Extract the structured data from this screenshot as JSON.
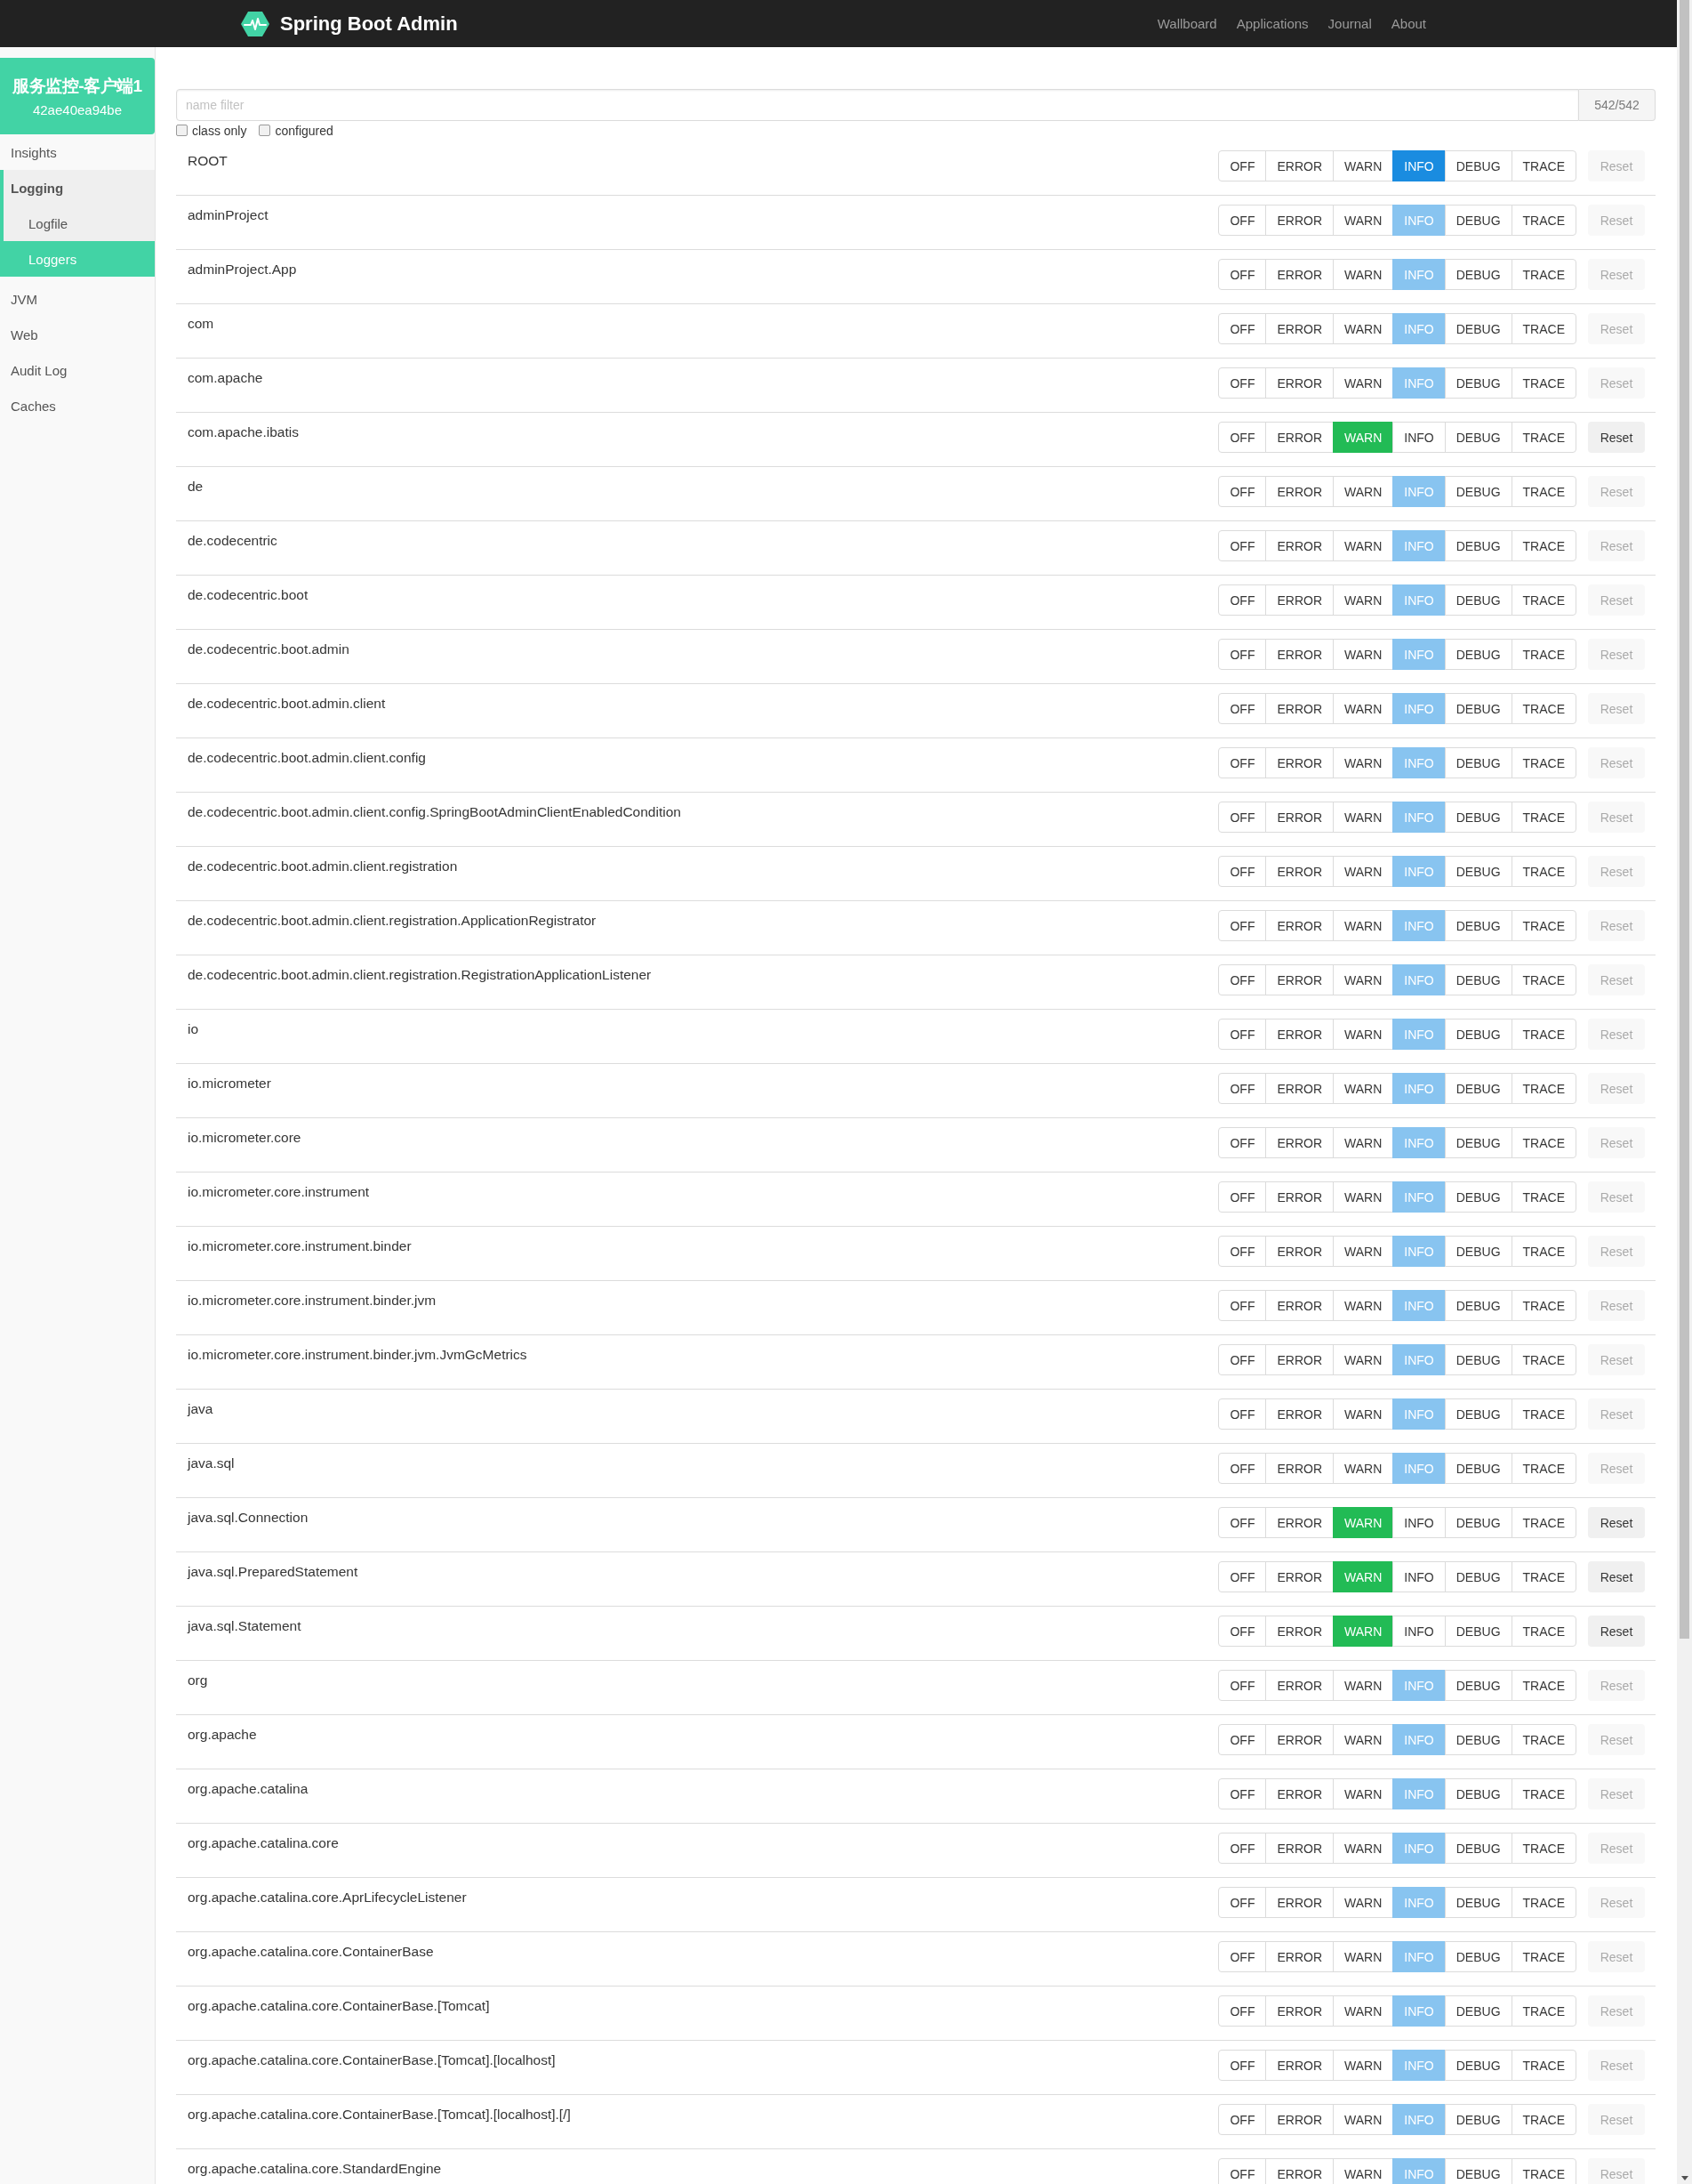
{
  "navbar": {
    "brand": "Spring Boot Admin",
    "links": [
      "Wallboard",
      "Applications",
      "Journal",
      "About"
    ]
  },
  "sidebar": {
    "app_name": "服务监控-客户端1",
    "instance_id": "42ae40ea94be",
    "items": [
      {
        "label": "Insights",
        "active": false
      },
      {
        "label": "Logging",
        "active": true,
        "children": [
          {
            "label": "Logfile",
            "selected": false
          },
          {
            "label": "Loggers",
            "selected": true
          }
        ]
      },
      {
        "label": "JVM",
        "active": false
      },
      {
        "label": "Web",
        "active": false
      },
      {
        "label": "Audit Log",
        "active": false
      },
      {
        "label": "Caches",
        "active": false
      }
    ]
  },
  "filter": {
    "placeholder": "name filter",
    "count": "542/542",
    "options": [
      {
        "label": "class only",
        "checked": false
      },
      {
        "label": "configured",
        "checked": false
      }
    ]
  },
  "loggers": [
    {
      "name": "ROOT",
      "configured": true,
      "levels": [
        {
          "label": "OFF",
          "selected": false
        },
        {
          "label": "ERROR",
          "selected": false
        },
        {
          "label": "WARN",
          "selected": false
        },
        {
          "label": "INFO",
          "selected": true
        },
        {
          "label": "DEBUG",
          "selected": false
        },
        {
          "label": "TRACE",
          "selected": false
        }
      ],
      "reset": {
        "label": "Reset",
        "disabled": true
      }
    },
    {
      "name": "adminProject",
      "configured": false,
      "levels": [
        {
          "label": "OFF",
          "selected": false
        },
        {
          "label": "ERROR",
          "selected": false
        },
        {
          "label": "WARN",
          "selected": false
        },
        {
          "label": "INFO",
          "selected": true
        },
        {
          "label": "DEBUG",
          "selected": false
        },
        {
          "label": "TRACE",
          "selected": false
        }
      ],
      "reset": {
        "label": "Reset",
        "disabled": true
      }
    },
    {
      "name": "adminProject.App",
      "configured": false,
      "levels": [
        {
          "label": "OFF",
          "selected": false
        },
        {
          "label": "ERROR",
          "selected": false
        },
        {
          "label": "WARN",
          "selected": false
        },
        {
          "label": "INFO",
          "selected": true
        },
        {
          "label": "DEBUG",
          "selected": false
        },
        {
          "label": "TRACE",
          "selected": false
        }
      ],
      "reset": {
        "label": "Reset",
        "disabled": true
      }
    },
    {
      "name": "com",
      "configured": false,
      "levels": [
        {
          "label": "OFF",
          "selected": false
        },
        {
          "label": "ERROR",
          "selected": false
        },
        {
          "label": "WARN",
          "selected": false
        },
        {
          "label": "INFO",
          "selected": true
        },
        {
          "label": "DEBUG",
          "selected": false
        },
        {
          "label": "TRACE",
          "selected": false
        }
      ],
      "reset": {
        "label": "Reset",
        "disabled": true
      }
    },
    {
      "name": "com.apache",
      "configured": false,
      "levels": [
        {
          "label": "OFF",
          "selected": false
        },
        {
          "label": "ERROR",
          "selected": false
        },
        {
          "label": "WARN",
          "selected": false
        },
        {
          "label": "INFO",
          "selected": true
        },
        {
          "label": "DEBUG",
          "selected": false
        },
        {
          "label": "TRACE",
          "selected": false
        }
      ],
      "reset": {
        "label": "Reset",
        "disabled": true
      }
    },
    {
      "name": "com.apache.ibatis",
      "configured": true,
      "levels": [
        {
          "label": "OFF",
          "selected": false
        },
        {
          "label": "ERROR",
          "selected": false
        },
        {
          "label": "WARN",
          "selected": true
        },
        {
          "label": "INFO",
          "selected": false
        },
        {
          "label": "DEBUG",
          "selected": false
        },
        {
          "label": "TRACE",
          "selected": false
        }
      ],
      "reset": {
        "label": "Reset",
        "disabled": false
      }
    },
    {
      "name": "de",
      "configured": false,
      "levels": [
        {
          "label": "OFF",
          "selected": false
        },
        {
          "label": "ERROR",
          "selected": false
        },
        {
          "label": "WARN",
          "selected": false
        },
        {
          "label": "INFO",
          "selected": true
        },
        {
          "label": "DEBUG",
          "selected": false
        },
        {
          "label": "TRACE",
          "selected": false
        }
      ],
      "reset": {
        "label": "Reset",
        "disabled": true
      }
    },
    {
      "name": "de.codecentric",
      "configured": false,
      "levels": [
        {
          "label": "OFF",
          "selected": false
        },
        {
          "label": "ERROR",
          "selected": false
        },
        {
          "label": "WARN",
          "selected": false
        },
        {
          "label": "INFO",
          "selected": true
        },
        {
          "label": "DEBUG",
          "selected": false
        },
        {
          "label": "TRACE",
          "selected": false
        }
      ],
      "reset": {
        "label": "Reset",
        "disabled": true
      }
    },
    {
      "name": "de.codecentric.boot",
      "configured": false,
      "levels": [
        {
          "label": "OFF",
          "selected": false
        },
        {
          "label": "ERROR",
          "selected": false
        },
        {
          "label": "WARN",
          "selected": false
        },
        {
          "label": "INFO",
          "selected": true
        },
        {
          "label": "DEBUG",
          "selected": false
        },
        {
          "label": "TRACE",
          "selected": false
        }
      ],
      "reset": {
        "label": "Reset",
        "disabled": true
      }
    },
    {
      "name": "de.codecentric.boot.admin",
      "configured": false,
      "levels": [
        {
          "label": "OFF",
          "selected": false
        },
        {
          "label": "ERROR",
          "selected": false
        },
        {
          "label": "WARN",
          "selected": false
        },
        {
          "label": "INFO",
          "selected": true
        },
        {
          "label": "DEBUG",
          "selected": false
        },
        {
          "label": "TRACE",
          "selected": false
        }
      ],
      "reset": {
        "label": "Reset",
        "disabled": true
      }
    },
    {
      "name": "de.codecentric.boot.admin.client",
      "configured": false,
      "levels": [
        {
          "label": "OFF",
          "selected": false
        },
        {
          "label": "ERROR",
          "selected": false
        },
        {
          "label": "WARN",
          "selected": false
        },
        {
          "label": "INFO",
          "selected": true
        },
        {
          "label": "DEBUG",
          "selected": false
        },
        {
          "label": "TRACE",
          "selected": false
        }
      ],
      "reset": {
        "label": "Reset",
        "disabled": true
      }
    },
    {
      "name": "de.codecentric.boot.admin.client.config",
      "configured": false,
      "levels": [
        {
          "label": "OFF",
          "selected": false
        },
        {
          "label": "ERROR",
          "selected": false
        },
        {
          "label": "WARN",
          "selected": false
        },
        {
          "label": "INFO",
          "selected": true
        },
        {
          "label": "DEBUG",
          "selected": false
        },
        {
          "label": "TRACE",
          "selected": false
        }
      ],
      "reset": {
        "label": "Reset",
        "disabled": true
      }
    },
    {
      "name": "de.codecentric.boot.admin.client.config.SpringBootAdminClientEnabledCondition",
      "configured": false,
      "levels": [
        {
          "label": "OFF",
          "selected": false
        },
        {
          "label": "ERROR",
          "selected": false
        },
        {
          "label": "WARN",
          "selected": false
        },
        {
          "label": "INFO",
          "selected": true
        },
        {
          "label": "DEBUG",
          "selected": false
        },
        {
          "label": "TRACE",
          "selected": false
        }
      ],
      "reset": {
        "label": "Reset",
        "disabled": true
      }
    },
    {
      "name": "de.codecentric.boot.admin.client.registration",
      "configured": false,
      "levels": [
        {
          "label": "OFF",
          "selected": false
        },
        {
          "label": "ERROR",
          "selected": false
        },
        {
          "label": "WARN",
          "selected": false
        },
        {
          "label": "INFO",
          "selected": true
        },
        {
          "label": "DEBUG",
          "selected": false
        },
        {
          "label": "TRACE",
          "selected": false
        }
      ],
      "reset": {
        "label": "Reset",
        "disabled": true
      }
    },
    {
      "name": "de.codecentric.boot.admin.client.registration.ApplicationRegistrator",
      "configured": false,
      "levels": [
        {
          "label": "OFF",
          "selected": false
        },
        {
          "label": "ERROR",
          "selected": false
        },
        {
          "label": "WARN",
          "selected": false
        },
        {
          "label": "INFO",
          "selected": true
        },
        {
          "label": "DEBUG",
          "selected": false
        },
        {
          "label": "TRACE",
          "selected": false
        }
      ],
      "reset": {
        "label": "Reset",
        "disabled": true
      }
    },
    {
      "name": "de.codecentric.boot.admin.client.registration.RegistrationApplicationListener",
      "configured": false,
      "levels": [
        {
          "label": "OFF",
          "selected": false
        },
        {
          "label": "ERROR",
          "selected": false
        },
        {
          "label": "WARN",
          "selected": false
        },
        {
          "label": "INFO",
          "selected": true
        },
        {
          "label": "DEBUG",
          "selected": false
        },
        {
          "label": "TRACE",
          "selected": false
        }
      ],
      "reset": {
        "label": "Reset",
        "disabled": true
      }
    },
    {
      "name": "io",
      "configured": false,
      "levels": [
        {
          "label": "OFF",
          "selected": false
        },
        {
          "label": "ERROR",
          "selected": false
        },
        {
          "label": "WARN",
          "selected": false
        },
        {
          "label": "INFO",
          "selected": true
        },
        {
          "label": "DEBUG",
          "selected": false
        },
        {
          "label": "TRACE",
          "selected": false
        }
      ],
      "reset": {
        "label": "Reset",
        "disabled": true
      }
    },
    {
      "name": "io.micrometer",
      "configured": false,
      "levels": [
        {
          "label": "OFF",
          "selected": false
        },
        {
          "label": "ERROR",
          "selected": false
        },
        {
          "label": "WARN",
          "selected": false
        },
        {
          "label": "INFO",
          "selected": true
        },
        {
          "label": "DEBUG",
          "selected": false
        },
        {
          "label": "TRACE",
          "selected": false
        }
      ],
      "reset": {
        "label": "Reset",
        "disabled": true
      }
    },
    {
      "name": "io.micrometer.core",
      "configured": false,
      "levels": [
        {
          "label": "OFF",
          "selected": false
        },
        {
          "label": "ERROR",
          "selected": false
        },
        {
          "label": "WARN",
          "selected": false
        },
        {
          "label": "INFO",
          "selected": true
        },
        {
          "label": "DEBUG",
          "selected": false
        },
        {
          "label": "TRACE",
          "selected": false
        }
      ],
      "reset": {
        "label": "Reset",
        "disabled": true
      }
    },
    {
      "name": "io.micrometer.core.instrument",
      "configured": false,
      "levels": [
        {
          "label": "OFF",
          "selected": false
        },
        {
          "label": "ERROR",
          "selected": false
        },
        {
          "label": "WARN",
          "selected": false
        },
        {
          "label": "INFO",
          "selected": true
        },
        {
          "label": "DEBUG",
          "selected": false
        },
        {
          "label": "TRACE",
          "selected": false
        }
      ],
      "reset": {
        "label": "Reset",
        "disabled": true
      }
    },
    {
      "name": "io.micrometer.core.instrument.binder",
      "configured": false,
      "levels": [
        {
          "label": "OFF",
          "selected": false
        },
        {
          "label": "ERROR",
          "selected": false
        },
        {
          "label": "WARN",
          "selected": false
        },
        {
          "label": "INFO",
          "selected": true
        },
        {
          "label": "DEBUG",
          "selected": false
        },
        {
          "label": "TRACE",
          "selected": false
        }
      ],
      "reset": {
        "label": "Reset",
        "disabled": true
      }
    },
    {
      "name": "io.micrometer.core.instrument.binder.jvm",
      "configured": false,
      "levels": [
        {
          "label": "OFF",
          "selected": false
        },
        {
          "label": "ERROR",
          "selected": false
        },
        {
          "label": "WARN",
          "selected": false
        },
        {
          "label": "INFO",
          "selected": true
        },
        {
          "label": "DEBUG",
          "selected": false
        },
        {
          "label": "TRACE",
          "selected": false
        }
      ],
      "reset": {
        "label": "Reset",
        "disabled": true
      }
    },
    {
      "name": "io.micrometer.core.instrument.binder.jvm.JvmGcMetrics",
      "configured": false,
      "levels": [
        {
          "label": "OFF",
          "selected": false
        },
        {
          "label": "ERROR",
          "selected": false
        },
        {
          "label": "WARN",
          "selected": false
        },
        {
          "label": "INFO",
          "selected": true
        },
        {
          "label": "DEBUG",
          "selected": false
        },
        {
          "label": "TRACE",
          "selected": false
        }
      ],
      "reset": {
        "label": "Reset",
        "disabled": true
      }
    },
    {
      "name": "java",
      "configured": false,
      "levels": [
        {
          "label": "OFF",
          "selected": false
        },
        {
          "label": "ERROR",
          "selected": false
        },
        {
          "label": "WARN",
          "selected": false
        },
        {
          "label": "INFO",
          "selected": true
        },
        {
          "label": "DEBUG",
          "selected": false
        },
        {
          "label": "TRACE",
          "selected": false
        }
      ],
      "reset": {
        "label": "Reset",
        "disabled": true
      }
    },
    {
      "name": "java.sql",
      "configured": false,
      "levels": [
        {
          "label": "OFF",
          "selected": false
        },
        {
          "label": "ERROR",
          "selected": false
        },
        {
          "label": "WARN",
          "selected": false
        },
        {
          "label": "INFO",
          "selected": true
        },
        {
          "label": "DEBUG",
          "selected": false
        },
        {
          "label": "TRACE",
          "selected": false
        }
      ],
      "reset": {
        "label": "Reset",
        "disabled": true
      }
    },
    {
      "name": "java.sql.Connection",
      "configured": true,
      "levels": [
        {
          "label": "OFF",
          "selected": false
        },
        {
          "label": "ERROR",
          "selected": false
        },
        {
          "label": "WARN",
          "selected": true
        },
        {
          "label": "INFO",
          "selected": false
        },
        {
          "label": "DEBUG",
          "selected": false
        },
        {
          "label": "TRACE",
          "selected": false
        }
      ],
      "reset": {
        "label": "Reset",
        "disabled": false
      }
    },
    {
      "name": "java.sql.PreparedStatement",
      "configured": true,
      "levels": [
        {
          "label": "OFF",
          "selected": false
        },
        {
          "label": "ERROR",
          "selected": false
        },
        {
          "label": "WARN",
          "selected": true
        },
        {
          "label": "INFO",
          "selected": false
        },
        {
          "label": "DEBUG",
          "selected": false
        },
        {
          "label": "TRACE",
          "selected": false
        }
      ],
      "reset": {
        "label": "Reset",
        "disabled": false
      }
    },
    {
      "name": "java.sql.Statement",
      "configured": true,
      "levels": [
        {
          "label": "OFF",
          "selected": false
        },
        {
          "label": "ERROR",
          "selected": false
        },
        {
          "label": "WARN",
          "selected": true
        },
        {
          "label": "INFO",
          "selected": false
        },
        {
          "label": "DEBUG",
          "selected": false
        },
        {
          "label": "TRACE",
          "selected": false
        }
      ],
      "reset": {
        "label": "Reset",
        "disabled": false
      }
    },
    {
      "name": "org",
      "configured": false,
      "levels": [
        {
          "label": "OFF",
          "selected": false
        },
        {
          "label": "ERROR",
          "selected": false
        },
        {
          "label": "WARN",
          "selected": false
        },
        {
          "label": "INFO",
          "selected": true
        },
        {
          "label": "DEBUG",
          "selected": false
        },
        {
          "label": "TRACE",
          "selected": false
        }
      ],
      "reset": {
        "label": "Reset",
        "disabled": true
      }
    },
    {
      "name": "org.apache",
      "configured": false,
      "levels": [
        {
          "label": "OFF",
          "selected": false
        },
        {
          "label": "ERROR",
          "selected": false
        },
        {
          "label": "WARN",
          "selected": false
        },
        {
          "label": "INFO",
          "selected": true
        },
        {
          "label": "DEBUG",
          "selected": false
        },
        {
          "label": "TRACE",
          "selected": false
        }
      ],
      "reset": {
        "label": "Reset",
        "disabled": true
      }
    },
    {
      "name": "org.apache.catalina",
      "configured": false,
      "levels": [
        {
          "label": "OFF",
          "selected": false
        },
        {
          "label": "ERROR",
          "selected": false
        },
        {
          "label": "WARN",
          "selected": false
        },
        {
          "label": "INFO",
          "selected": true
        },
        {
          "label": "DEBUG",
          "selected": false
        },
        {
          "label": "TRACE",
          "selected": false
        }
      ],
      "reset": {
        "label": "Reset",
        "disabled": true
      }
    },
    {
      "name": "org.apache.catalina.core",
      "configured": false,
      "levels": [
        {
          "label": "OFF",
          "selected": false
        },
        {
          "label": "ERROR",
          "selected": false
        },
        {
          "label": "WARN",
          "selected": false
        },
        {
          "label": "INFO",
          "selected": true
        },
        {
          "label": "DEBUG",
          "selected": false
        },
        {
          "label": "TRACE",
          "selected": false
        }
      ],
      "reset": {
        "label": "Reset",
        "disabled": true
      }
    },
    {
      "name": "org.apache.catalina.core.AprLifecycleListener",
      "configured": false,
      "levels": [
        {
          "label": "OFF",
          "selected": false
        },
        {
          "label": "ERROR",
          "selected": false
        },
        {
          "label": "WARN",
          "selected": false
        },
        {
          "label": "INFO",
          "selected": true
        },
        {
          "label": "DEBUG",
          "selected": false
        },
        {
          "label": "TRACE",
          "selected": false
        }
      ],
      "reset": {
        "label": "Reset",
        "disabled": true
      }
    },
    {
      "name": "org.apache.catalina.core.ContainerBase",
      "configured": false,
      "levels": [
        {
          "label": "OFF",
          "selected": false
        },
        {
          "label": "ERROR",
          "selected": false
        },
        {
          "label": "WARN",
          "selected": false
        },
        {
          "label": "INFO",
          "selected": true
        },
        {
          "label": "DEBUG",
          "selected": false
        },
        {
          "label": "TRACE",
          "selected": false
        }
      ],
      "reset": {
        "label": "Reset",
        "disabled": true
      }
    },
    {
      "name": "org.apache.catalina.core.ContainerBase.[Tomcat]",
      "configured": false,
      "levels": [
        {
          "label": "OFF",
          "selected": false
        },
        {
          "label": "ERROR",
          "selected": false
        },
        {
          "label": "WARN",
          "selected": false
        },
        {
          "label": "INFO",
          "selected": true
        },
        {
          "label": "DEBUG",
          "selected": false
        },
        {
          "label": "TRACE",
          "selected": false
        }
      ],
      "reset": {
        "label": "Reset",
        "disabled": true
      }
    },
    {
      "name": "org.apache.catalina.core.ContainerBase.[Tomcat].[localhost]",
      "configured": false,
      "levels": [
        {
          "label": "OFF",
          "selected": false
        },
        {
          "label": "ERROR",
          "selected": false
        },
        {
          "label": "WARN",
          "selected": false
        },
        {
          "label": "INFO",
          "selected": true
        },
        {
          "label": "DEBUG",
          "selected": false
        },
        {
          "label": "TRACE",
          "selected": false
        }
      ],
      "reset": {
        "label": "Reset",
        "disabled": true
      }
    },
    {
      "name": "org.apache.catalina.core.ContainerBase.[Tomcat].[localhost].[/]",
      "configured": false,
      "levels": [
        {
          "label": "OFF",
          "selected": false
        },
        {
          "label": "ERROR",
          "selected": false
        },
        {
          "label": "WARN",
          "selected": false
        },
        {
          "label": "INFO",
          "selected": true
        },
        {
          "label": "DEBUG",
          "selected": false
        },
        {
          "label": "TRACE",
          "selected": false
        }
      ],
      "reset": {
        "label": "Reset",
        "disabled": true
      }
    },
    {
      "name": "org.apache.catalina.core.StandardEngine",
      "configured": false,
      "levels": [
        {
          "label": "OFF",
          "selected": false
        },
        {
          "label": "ERROR",
          "selected": false
        },
        {
          "label": "WARN",
          "selected": false
        },
        {
          "label": "INFO",
          "selected": true
        },
        {
          "label": "DEBUG",
          "selected": false
        },
        {
          "label": "TRACE",
          "selected": false
        }
      ],
      "reset": {
        "label": "Reset",
        "disabled": true
      }
    }
  ]
}
